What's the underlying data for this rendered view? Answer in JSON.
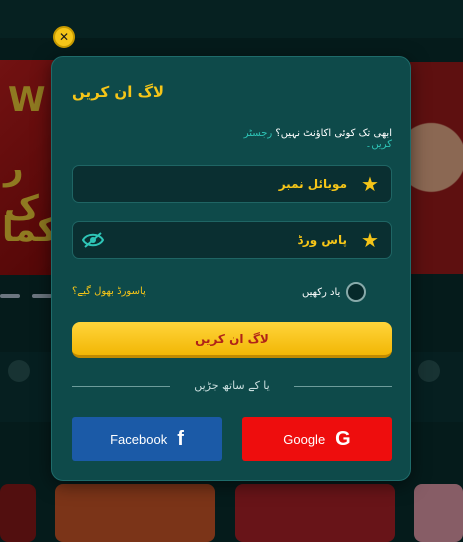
{
  "background": {
    "banner_text": [
      "W",
      "ر ک",
      "کما"
    ]
  },
  "modal": {
    "title": "لاگ ان کریں",
    "register_question": "ابھی تک کوئی اکاؤنٹ نہیں؟",
    "register_link": "رجسٹر کریں۔",
    "mobile_label": "موبائل نمبر",
    "password_label": "پاس ورڈ",
    "remember_label": "یاد رکھیں",
    "forgot_label": "پاسورڈ بھول گیے؟",
    "login_button": "لاگ ان کریں",
    "divider_text": "یا کے ساتھ جڑیں",
    "facebook_label": "Facebook",
    "google_label": "Google"
  },
  "icons": {
    "close": "close-icon",
    "star": "star-icon",
    "eye": "eye-slash-icon",
    "facebook": "facebook-icon",
    "google": "google-icon"
  },
  "colors": {
    "accent": "#f5c518",
    "modal_bg": "#0e4a4a",
    "facebook": "#1b5aa7",
    "google": "#ee0d0d",
    "link": "#2ec4b6"
  }
}
